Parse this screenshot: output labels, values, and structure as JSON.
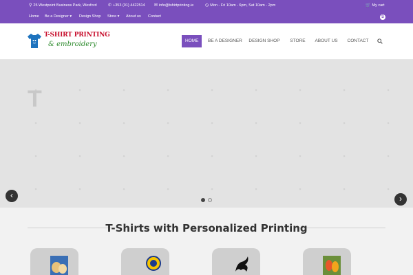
{
  "topbar": {
    "address": "25 Westpoint Business Park, Wexford",
    "phone": "+353 (01) 4422514",
    "email": "info@tshirtprinting.ie",
    "hours": "Mon - Fri 10am - 6pm, Sat 10am - 2pm",
    "cart": "My cart",
    "links": {
      "home": "Home",
      "designer": "Be a Designer",
      "design_shop": "Design Shop",
      "store": "Store",
      "about": "About us",
      "contact": "Contact"
    }
  },
  "logo": {
    "line1": "T-SHIRT PRINTING",
    "line2": "& embroidery"
  },
  "nav": {
    "home": "HOME",
    "designer": "BE A DESIGNER",
    "design_shop": "DESIGN SHOP",
    "store": "STORE",
    "about": "ABOUT US",
    "contact": "CONTACT"
  },
  "slider": {
    "letter": "T",
    "slides": 2,
    "active_slide": 1
  },
  "section": {
    "title": "T-Shirts with Personalized Printing"
  },
  "colors": {
    "brand": "#7a4fbd",
    "logo_red": "#c8102e",
    "logo_green": "#2e8b2e"
  }
}
